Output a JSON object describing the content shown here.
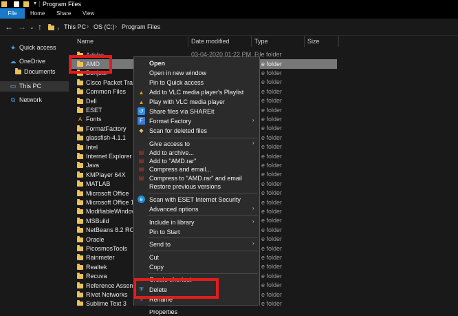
{
  "window": {
    "title": "Program Files"
  },
  "ribbon": {
    "tabs": [
      "File",
      "Home",
      "Share",
      "View"
    ]
  },
  "address": {
    "crumbs": [
      "This PC",
      "OS (C:)",
      "Program Files"
    ]
  },
  "nav": {
    "items": [
      {
        "label": "Quick access",
        "icon": "star-icon"
      },
      {
        "label": "OneDrive",
        "icon": "cloud-icon"
      },
      {
        "label": "Documents",
        "icon": "folder-icon"
      },
      {
        "label": "This PC",
        "icon": "computer-icon"
      },
      {
        "label": "Network",
        "icon": "network-icon"
      }
    ]
  },
  "columns": {
    "name": "Name",
    "date": "Date modified",
    "type": "Type",
    "size": "Size"
  },
  "files": {
    "first_row": {
      "date": "03-04-2020 01:22 PM",
      "type": "File folder"
    },
    "selected_type_fragment": "e folder",
    "items": [
      "AMD",
      "Bonjour",
      "Cisco Packet Tracer",
      "Common Files",
      "Dell",
      "ESET",
      "Fonts",
      "FormatFactory",
      "glassfish-4.1.1",
      "Intel",
      "Internet Explorer",
      "Java",
      "KMPlayer 64X",
      "MATLAB",
      "Microsoft Office",
      "Microsoft Office 15",
      "ModifiableWindowsApps",
      "MSBuild",
      "NetBeans 8.2 RC",
      "Oracle",
      "PicosmosTools",
      "Rainmeter",
      "Realtek",
      "Recuva",
      "Reference Assemblies",
      "Rivet Networks",
      "Sublime Text 3"
    ],
    "type_fragments": [
      "e folder",
      "e folder",
      "e folder",
      "e folder",
      "e folder",
      "e folder",
      "e folder",
      "e folder",
      "e folder",
      "e folder",
      "e folder",
      "e folder",
      "e folder",
      "e folder",
      "e folder",
      "e folder",
      "e folder",
      "e folder",
      "e folder",
      "e folder",
      "e folder",
      "e folder",
      "e folder",
      "e folder",
      "e folder",
      "e folder"
    ]
  },
  "context_menu": {
    "open": "Open",
    "open_new_window": "Open in new window",
    "pin_quick": "Pin to Quick access",
    "vlc_playlist": "Add to VLC media player's Playlist",
    "vlc_play": "Play with VLC media player",
    "shareit": "Share files via SHAREit",
    "format_factory": "Format Factory",
    "scan_deleted": "Scan for deleted files",
    "give_access": "Give access to",
    "add_archive": "Add to archive...",
    "add_amd_rar": "Add to \"AMD.rar\"",
    "compress_email": "Compress and email...",
    "compress_amd_email": "Compress to \"AMD.rar\" and email",
    "restore_versions": "Restore previous versions",
    "scan_eset": "Scan with ESET Internet Security",
    "advanced": "Advanced options",
    "include_library": "Include in library",
    "pin_start": "Pin to Start",
    "send_to": "Send to",
    "cut": "Cut",
    "copy": "Copy",
    "create_shortcut": "Create shortcut",
    "delete": "Delete",
    "rename": "Rename",
    "properties": "Properties",
    "submenu_arrow": "›"
  },
  "colors": {
    "highlight": "#e21c1c",
    "file_tab": "#1979ca",
    "folder": "#e8c15a"
  }
}
